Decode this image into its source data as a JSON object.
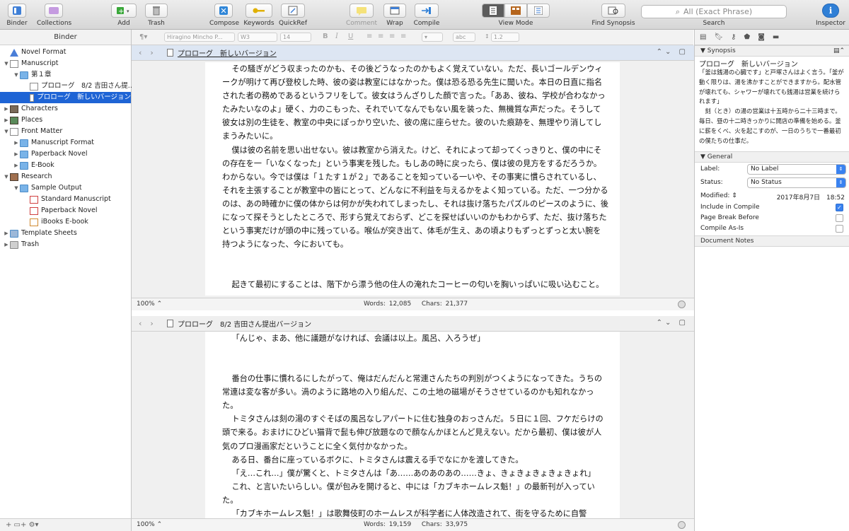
{
  "toolbar": {
    "binder": "Binder",
    "collections": "Collections",
    "add": "Add",
    "trash": "Trash",
    "compose": "Compose",
    "keywords": "Keywords",
    "quickref": "QuickRef",
    "comment": "Comment",
    "wrap": "Wrap",
    "compile": "Compile",
    "view_mode": "View Mode",
    "find_synopsis": "Find Synopsis",
    "search_placeholder": "All (Exact Phrase)",
    "search_label": "Search",
    "inspector": "Inspector"
  },
  "format_bar": {
    "style": "¶",
    "font": "Hiragino Mincho P...",
    "weight": "W3",
    "size": "14",
    "line_spacing": "1.2",
    "case": "abc"
  },
  "binder": {
    "header": "Binder",
    "items": [
      {
        "label": "Novel Format"
      },
      {
        "label": "Manuscript"
      },
      {
        "label": "第１章"
      },
      {
        "label": "プロローグ　8/2 吉田さん提..."
      },
      {
        "label": "プロローグ　新しいバージョン"
      },
      {
        "label": "Characters"
      },
      {
        "label": "Places"
      },
      {
        "label": "Front Matter"
      },
      {
        "label": "Manuscript Format"
      },
      {
        "label": "Paperback Novel"
      },
      {
        "label": "E-Book"
      },
      {
        "label": "Research"
      },
      {
        "label": "Sample Output"
      },
      {
        "label": "Standard Manuscript"
      },
      {
        "label": "Paperback Novel"
      },
      {
        "label": "iBooks E-book"
      },
      {
        "label": "Template Sheets"
      },
      {
        "label": "Trash"
      }
    ],
    "footer": "+  ▭+  ⚙▾"
  },
  "editor_top": {
    "title": "プロローグ　新しいバージョン",
    "zoom": "100%",
    "words": "Words: 12,085",
    "chars": "Chars: 21,377",
    "paragraphs": [
      "その騒ぎがどう収まったのかも、その後どうなったのかもよく覚えていない。ただ、長いゴールデンウィークが明けて再び登校した時、彼の姿は教室にはなかった。僕は恐る恐る先生に聞いた。本日の日直に指名された者の務めであるというフリをして。彼女はうんざりした顔で言った。「ああ、彼ね、学校が合わなかったみたいなのよ」硬く、力のこもった、それでいてなんでもない風を装った、無機質な声だった。そうして彼女は別の生徒を、教室の中央にぽっかり空いた、彼の席に座らせた。彼のいた痕跡を、無理やり消してしまうみたいに。",
      "僕は彼の名前を思い出せない。彼は教室から消えた。けど、それによって却ってくっきりと、僕の中にその存在を一「いなくなった」という事実を残した。もしあの時に戻ったら、僕は彼の見方をするだろうか。わからない。今では僕は「１たす１が２」であることを知っている一いや、その事実に慣らされているし、それを主張することが教室中の皆にとって、どんなに不利益を与えるかをよく知っている。ただ、一つ分かるのは、あの時確かに僕の体からは何かが失われてしまったし、それは抜け落ちたパズルのピースのように、後になって探そうとしたところで、形すら覚えておらず、どこを探せばいいのかもわからず、ただ、抜け落ちたという事実だけが頭の中に残っている。喉仏が突き出て、体毛が生え、あの頃よりもずっとずっと太い腕を持つようになった、今においても。",
      "",
      "起きて最初にすることは、階下から漂う他の住人の淹れたコーヒーの匂いを胸いっぱいに吸い込むこと。"
    ]
  },
  "editor_bottom": {
    "title": "プロローグ　8/2 吉田さん提出バージョン",
    "zoom": "100%",
    "words": "Words: 19,159",
    "chars": "Chars: 33,975",
    "paragraphs": [
      "「んじゃ、まあ、他に議題がなければ、会議は以上。風呂、入ろうぜ」",
      "",
      "番台の仕事に慣れるにしたがって、俺はだんだんと常連さんたちの判別がつくようになってきた。うちの常連は変な客が多い。渦のように路地の入り組んだ、この土地の磁場がそうさせているのかも知れなかった。",
      "トミタさんは刻の湯のすぐそばの風呂なしアパートに住む独身のおっさんだ。５日に１回、フケだらけの頭で来る。おまけにひどい猫背で髭も伸び放題なので顔なんかほとんど見えない。だから最初、僕は彼が人気のプロ漫画家だということに全く気付かなかった。",
      "ある日、番台に座っているボクに、トミタさんは震える手でなにかを渡してきた。",
      "「え…これ…」僕が驚くと、トミタさんは「あ……あのあのあの……きょ、きょきょきょきょきょれ」",
      "これ、と言いたいらしい。僕が包みを開けると、中には「カブキホームレス魁！」の最新刊が入っていた。",
      "「カブキホームレス魁！」は歌舞伎町のホームレスが科学者に人体改造されて、街を守るために自警"
    ]
  },
  "inspector": {
    "synopsis_header": "Synopsis",
    "synopsis_title": "プロローグ　新しいバージョン",
    "synopsis_text": "「釜は銭湯の心臓です」と戸塚さんはよく言う。「釜が動く限りは、湯を沸かすことができますから。配水管が壊れても、シャワーが壊れても銭湯は営業を続けられます」\n　刻（とき）の湯の営業は十五時から二十三時まで。毎日、昼の十二時きっかりに開店の準備を始める。釜に薪をくべ、火を起こすのが、一日のうちで一番最初の僕たちの仕事だ。",
    "general_header": "General",
    "label_key": "Label:",
    "label_value": "No Label",
    "status_key": "Status:",
    "status_value": "No Status",
    "modified_key": "Modified:",
    "modified_value": "2017年8月7日　18:52",
    "include_compile": "Include in Compile",
    "include_compile_checked": true,
    "page_break": "Page Break Before",
    "page_break_checked": false,
    "compile_as_is": "Compile As-Is",
    "compile_as_is_checked": false,
    "document_notes": "Document Notes"
  },
  "colors": {
    "selection": "#1e64d5",
    "accent": "#3a82f0"
  }
}
